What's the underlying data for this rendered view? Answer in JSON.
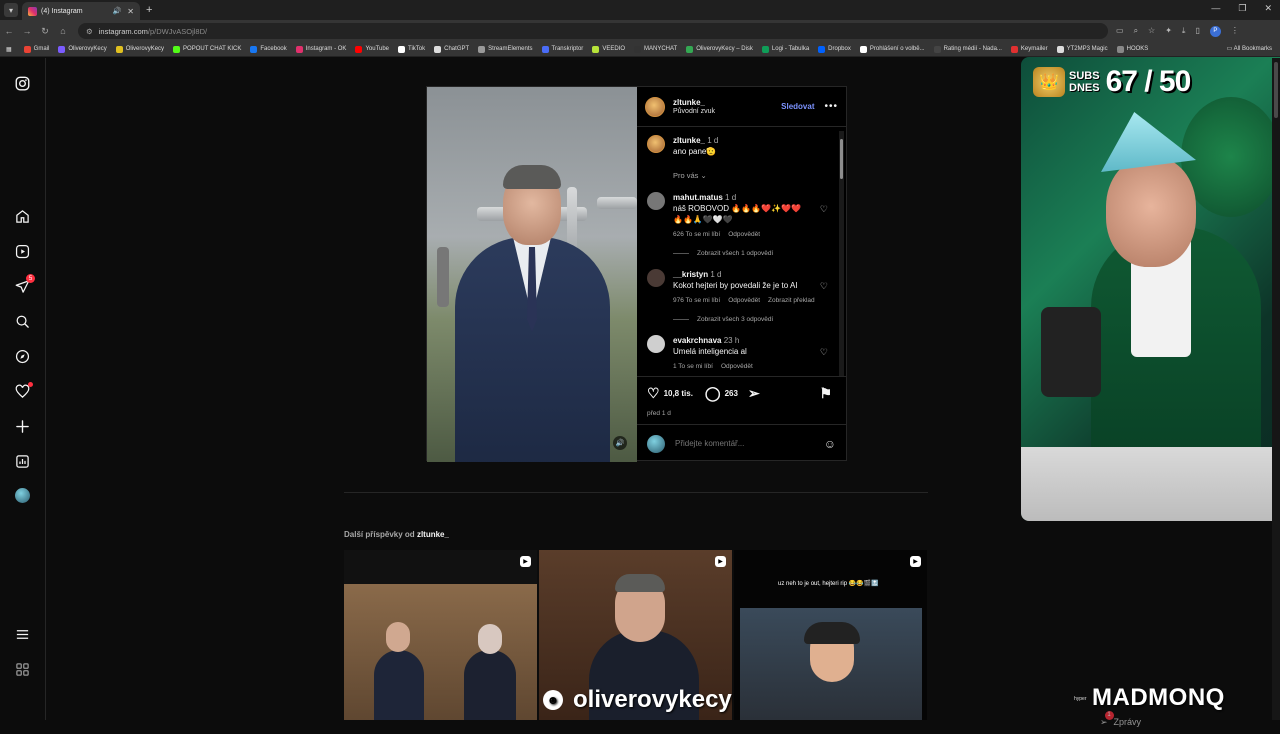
{
  "browser": {
    "tab_title": "(4) Instagram",
    "url_host": "instagram.com",
    "url_path": "/p/DWJvASOjl8D/",
    "bookmarks": [
      {
        "label": "Gmail",
        "color": "#ea4335"
      },
      {
        "label": "OliverovyKecy",
        "color": "#7b5cff"
      },
      {
        "label": "OliverovyKecy",
        "color": "#e0c020"
      },
      {
        "label": "POPOUT CHAT KICK",
        "color": "#53fc18"
      },
      {
        "label": "Facebook",
        "color": "#1877f2"
      },
      {
        "label": "Instagram - OK",
        "color": "#e1306c"
      },
      {
        "label": "YouTube",
        "color": "#ff0000"
      },
      {
        "label": "TikTok",
        "color": "#ffffff"
      },
      {
        "label": "ChatGPT",
        "color": "#dddddd"
      },
      {
        "label": "StreamElements",
        "color": "#999999"
      },
      {
        "label": "Transkriptor",
        "color": "#4a6cf7"
      },
      {
        "label": "VEEDIO",
        "color": "#b7e33a"
      },
      {
        "label": "MANYCHAT",
        "color": "#333333"
      },
      {
        "label": "OliverovyKecy – Disk",
        "color": "#34a853"
      },
      {
        "label": "Logi - Tabulka",
        "color": "#0f9d58"
      },
      {
        "label": "Dropbox",
        "color": "#0061fe"
      },
      {
        "label": "Prohlášení o volbě...",
        "color": "#ffffff"
      },
      {
        "label": "Rating médií - Nada...",
        "color": "#444444"
      },
      {
        "label": "Keymailer",
        "color": "#e03030"
      },
      {
        "label": "YT2MP3 Magic",
        "color": "#dddddd"
      },
      {
        "label": "HOOKS",
        "color": "#888888"
      }
    ],
    "all_bookmarks": "All Bookmarks"
  },
  "post": {
    "username": "zltunke_",
    "audio": "Původní zvuk",
    "follow": "Sledovat",
    "caption_user": "zltunke_",
    "caption_time": "1 d",
    "caption_text": "ano pane🫡",
    "for_you": "Pro vás",
    "comments": [
      {
        "user": "mahut.matus",
        "time": "1 d",
        "text": "náš ROBOVOD 🔥🔥🔥❤️✨❤️❤️",
        "text2": "🔥🔥🙏🖤🤍🖤",
        "likes": "626 To se mi líbí",
        "reply": "Odpovědět",
        "translate": "",
        "view_replies": "Zobrazit všech 1 odpovědí",
        "avatar_color": "#777777"
      },
      {
        "user": "__kristyn",
        "time": "1 d",
        "text": "Kokot hejteri by povedali že je to AI",
        "text2": "",
        "likes": "976 To se mi líbí",
        "reply": "Odpovědět",
        "translate": "Zobrazit překlad",
        "view_replies": "Zobrazit všech 3 odpovědí",
        "avatar_color": "#4a3a35"
      },
      {
        "user": "evakrchnava",
        "time": "23 h",
        "text": "Umelá inteligencia al",
        "text2": "",
        "likes": "1 To se mi líbí",
        "reply": "Odpovědět",
        "translate": "",
        "view_replies": "",
        "avatar_color": "#cfcfcf"
      }
    ],
    "like_count": "10,8 tis.",
    "comment_count": "263",
    "date": "před 1 d",
    "add_comment_placeholder": "Přidejte komentář..."
  },
  "more_posts": {
    "prefix": "Další příspěvky od",
    "user": "zltunke_",
    "thumb2_caption": "uz neh to je out, hejteri rip 😂😂🎬🔝"
  },
  "stream": {
    "subs_label_1": "SUBS",
    "subs_label_2": "DNES",
    "subs_count": "67 / 50",
    "brand": "oliverovykecy",
    "sponsor": "MADMONQ",
    "sponsor_pre": "hyper",
    "messages": "Zprávy",
    "messages_badge": "1"
  },
  "sidebar": {
    "notifications_badge": "5"
  }
}
